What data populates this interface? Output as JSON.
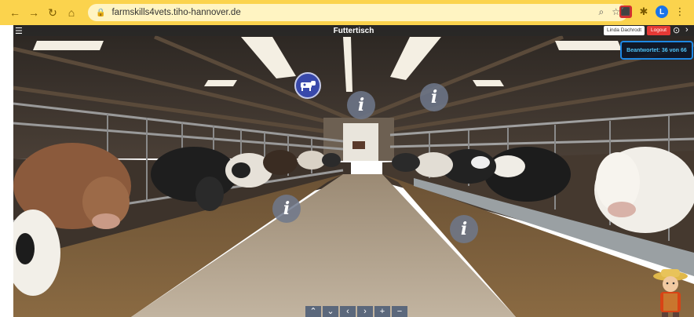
{
  "browser": {
    "url": "farmskills4vets.tiho-hannover.de",
    "avatar_letter": "L",
    "colors": {
      "toolbar": "#fbd34d",
      "omnibox": "#fff4c2"
    }
  },
  "tour": {
    "title": "Futtertisch",
    "user_name": "Linda Dachrodt",
    "logout_label": "Logout",
    "answered_label": "Beantwortet: 36 von 66",
    "info_glyph": "i",
    "controls": [
      "⌃",
      "⌄",
      "‹",
      "›",
      "+",
      "−"
    ],
    "colors": {
      "hotspot": "#6e788c",
      "cow_hotspot": "#3949ab",
      "logout": "#e53935",
      "answered_border": "#1e88e5"
    }
  }
}
